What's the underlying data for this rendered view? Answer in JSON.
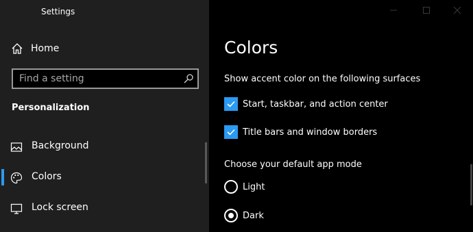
{
  "window": {
    "title": "Settings"
  },
  "sidebar": {
    "home_label": "Home",
    "search_placeholder": "Find a setting",
    "section_title": "Personalization",
    "items": [
      {
        "label": "Background",
        "icon": "image-icon",
        "active": false
      },
      {
        "label": "Colors",
        "icon": "palette-icon",
        "active": true
      },
      {
        "label": "Lock screen",
        "icon": "monitor-icon",
        "active": false
      }
    ]
  },
  "main": {
    "title": "Colors",
    "accent_heading": "Show accent color on the following surfaces",
    "checkboxes": [
      {
        "label": "Start, taskbar, and action center",
        "checked": true
      },
      {
        "label": "Title bars and window borders",
        "checked": true
      }
    ],
    "app_mode_heading": "Choose your default app mode",
    "radios": [
      {
        "label": "Light",
        "selected": false
      },
      {
        "label": "Dark",
        "selected": true
      }
    ]
  },
  "colors": {
    "accent": "#2b9af3",
    "sidebar_bg": "#1f1f1f",
    "main_bg": "#000000"
  }
}
